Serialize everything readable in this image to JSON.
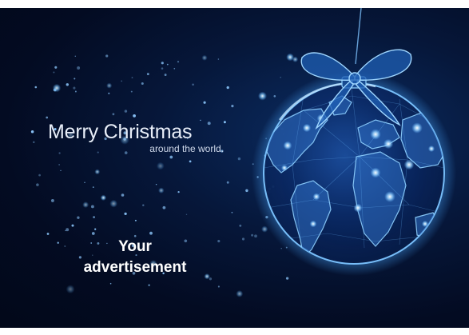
{
  "greeting": {
    "title": "Merry Christmas",
    "subtitle": "around the world."
  },
  "advertisement": {
    "line1": "Your",
    "line2": "advertisement"
  },
  "artwork": {
    "icon": "globe-ornament-icon",
    "background_color": "#030b22",
    "glow_color": "#5fb3ff"
  }
}
